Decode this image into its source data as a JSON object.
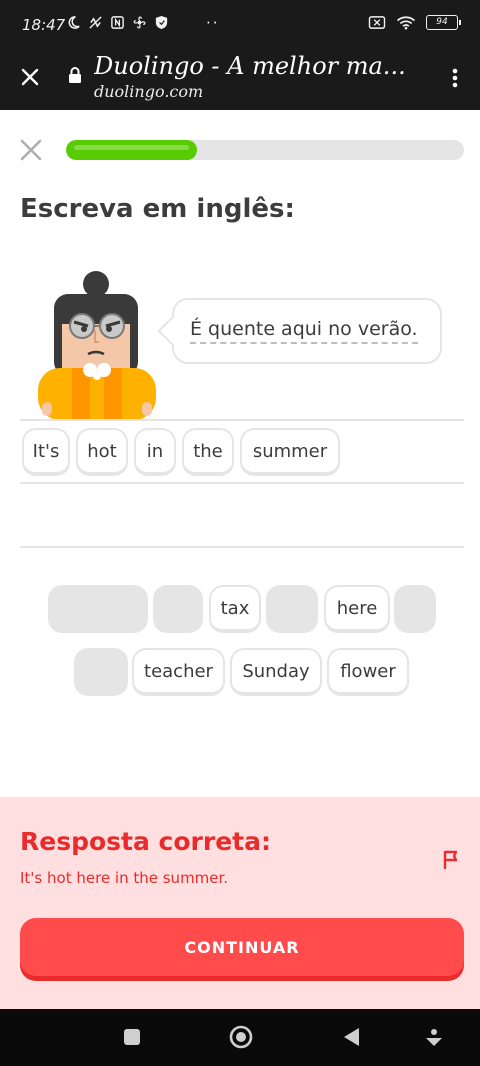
{
  "status_bar": {
    "time": "18:47",
    "dots": "··",
    "battery": "94"
  },
  "browser": {
    "title": "Duolingo - A melhor ma...",
    "url": "duolingo.com"
  },
  "lesson": {
    "progress": 0.33,
    "prompt": "Escreva em inglês:",
    "sentence": "É quente aqui no verão.",
    "selected_tiles": [
      "It's",
      "hot",
      "in",
      "the",
      "summer"
    ],
    "word_bank_row1": [
      {
        "label": "",
        "empty": true
      },
      {
        "label": "",
        "empty": true
      },
      {
        "label": "tax",
        "empty": false
      },
      {
        "label": "",
        "empty": true
      },
      {
        "label": "here",
        "empty": false
      },
      {
        "label": "",
        "empty": true
      }
    ],
    "word_bank_row2": [
      {
        "label": "",
        "empty": true
      },
      {
        "label": "teacher",
        "empty": false
      },
      {
        "label": "Sunday",
        "empty": false
      },
      {
        "label": "flower",
        "empty": false
      }
    ]
  },
  "feedback": {
    "title": "Resposta correta:",
    "answer": "It's hot here in the summer.",
    "continue_label": "CONTINUAR",
    "colors": {
      "background": "#ffdfe0",
      "accent": "#ea2b2b",
      "button": "#ff4b4b"
    }
  },
  "icons": [
    "moon-icon",
    "wifi-icon",
    "lock-icon",
    "close-icon",
    "flag-icon",
    "kebab-menu-icon",
    "square-nav-icon",
    "home-circle-nav-icon",
    "back-triangle-nav-icon"
  ],
  "colors": {
    "progress": "#58cc02",
    "border": "#e5e5e5"
  }
}
